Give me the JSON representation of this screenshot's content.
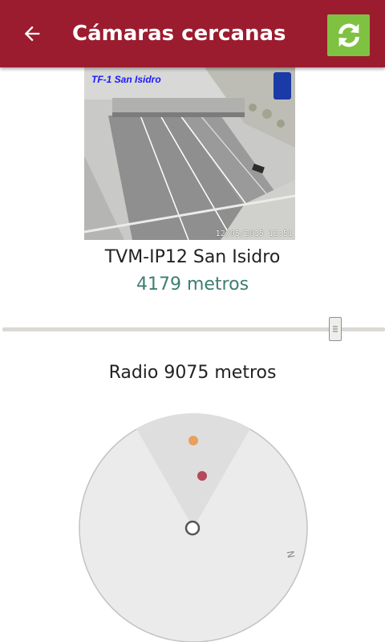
{
  "app_bar": {
    "title": "Cámaras cercanas",
    "back_icon": "arrow-left-icon",
    "refresh_icon": "refresh-icon",
    "color": "#9b1c2e",
    "refresh_color": "#7fc242"
  },
  "camera": {
    "overlay_label": "TF-1 San Isidro",
    "overlay_timestamp": "12/05/2015 12:51",
    "name": "TVM-IP12 San Isidro",
    "distance": "4179 metros"
  },
  "radius_slider": {
    "value_fraction": 0.87
  },
  "radius": {
    "label": "Radio 9075 metros"
  },
  "radar": {
    "compass_letter": "N",
    "marker_colors": [
      "#e8a05c",
      "#b5485a"
    ]
  }
}
